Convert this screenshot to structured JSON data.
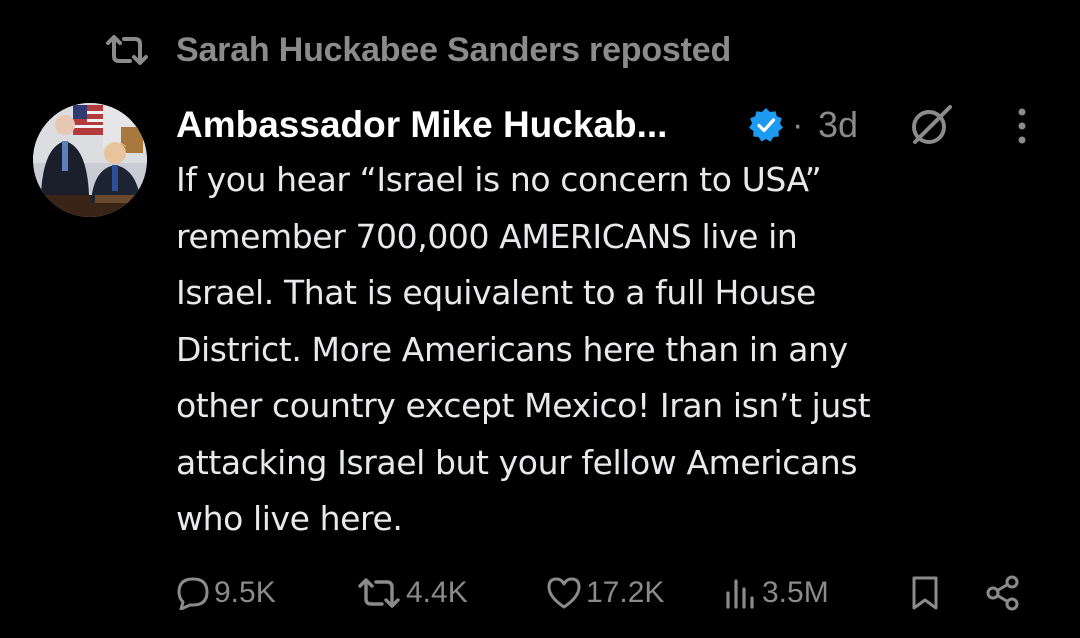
{
  "repost": {
    "icon": "repost-icon",
    "label": "Sarah Huckabee Sanders reposted"
  },
  "post": {
    "author": {
      "display_name": "Ambassador Mike Huckab...",
      "verified": true,
      "avatar": "avatar-photo"
    },
    "separator": "·",
    "timestamp": "3d",
    "text": "If you hear “Israel is no concern to USA”\nremember 700,000 AMERICANS live in\nIsrael.  That is equivalent to a full House\nDistrict.  More Americans here than in any\nother country except Mexico!  Iran isn’t just\nattacking Israel but your fellow Americans\nwho live here.",
    "actions": {
      "replies": "9.5K",
      "reposts": "4.4K",
      "likes": "17.2K",
      "views": "3.5M"
    }
  },
  "colors": {
    "background": "#000000",
    "text_primary": "#e7e9ea",
    "text_secondary": "#8b8b8b",
    "verified_blue": "#1d9bf0"
  },
  "icons": {
    "repost": "repost-icon",
    "verified": "verified-badge-icon",
    "grok": "grok-icon",
    "more": "more-options-icon",
    "reply": "reply-icon",
    "retweet": "retweet-icon",
    "like": "heart-icon",
    "views": "views-chart-icon",
    "bookmark": "bookmark-icon",
    "share": "share-icon"
  }
}
